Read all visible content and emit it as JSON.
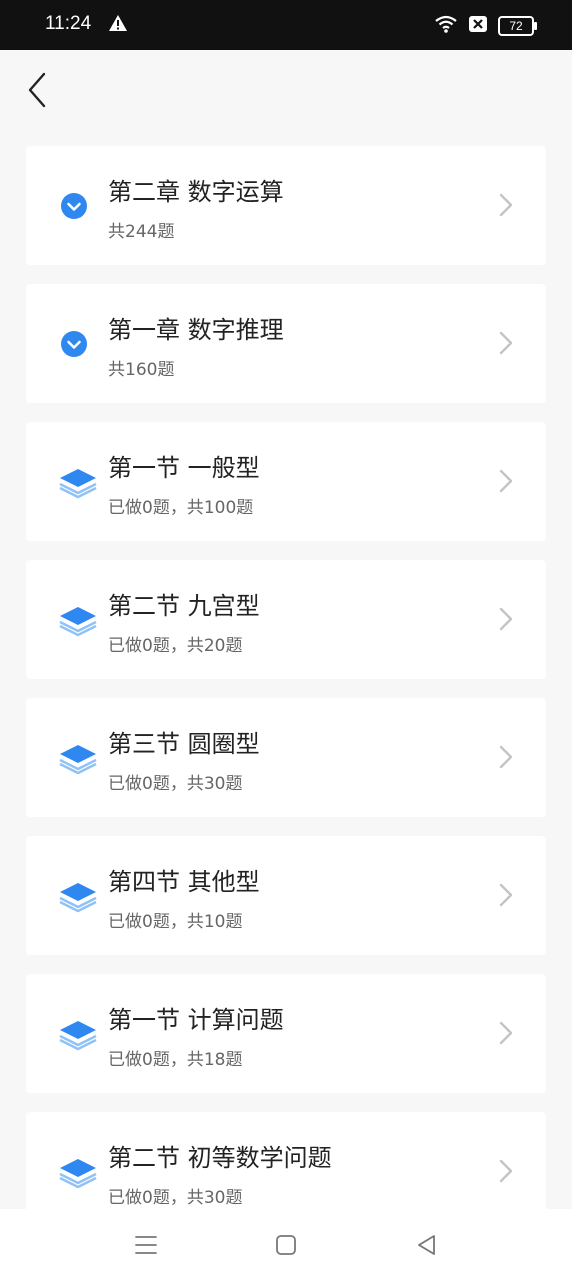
{
  "status_bar": {
    "time": "11:24",
    "battery": "72",
    "icons": [
      "warning-icon",
      "wifi-icon",
      "sim-off-icon",
      "battery-icon"
    ]
  },
  "header": {
    "back_icon": "chevron-left-icon"
  },
  "items": [
    {
      "title": "第二章 数字运算",
      "subtitle": "共244题",
      "type": "chapter",
      "icon": "check-circle-icon"
    },
    {
      "title": "第一章 数字推理",
      "subtitle": "共160题",
      "type": "chapter",
      "icon": "check-circle-icon"
    },
    {
      "title": "第一节 一般型",
      "subtitle": "已做0题，共100题",
      "type": "section",
      "icon": "layers-icon"
    },
    {
      "title": "第二节 九宫型",
      "subtitle": "已做0题，共20题",
      "type": "section",
      "icon": "layers-icon"
    },
    {
      "title": "第三节 圆圈型",
      "subtitle": "已做0题，共30题",
      "type": "section",
      "icon": "layers-icon"
    },
    {
      "title": "第四节 其他型",
      "subtitle": "已做0题，共10题",
      "type": "section",
      "icon": "layers-icon"
    },
    {
      "title": "第一节 计算问题",
      "subtitle": "已做0题，共18题",
      "type": "section",
      "icon": "layers-icon"
    },
    {
      "title": "第二节 初等数学问题",
      "subtitle": "已做0题，共30题",
      "type": "section",
      "icon": "layers-icon"
    }
  ],
  "nav_bar": {
    "icons": [
      "menu-icon",
      "home-icon",
      "back-triangle-icon"
    ]
  },
  "colors": {
    "accent": "#2f87f0",
    "accent_light": "#8fc2f8",
    "status_bar": "#111111",
    "background": "#f7f7f7"
  }
}
